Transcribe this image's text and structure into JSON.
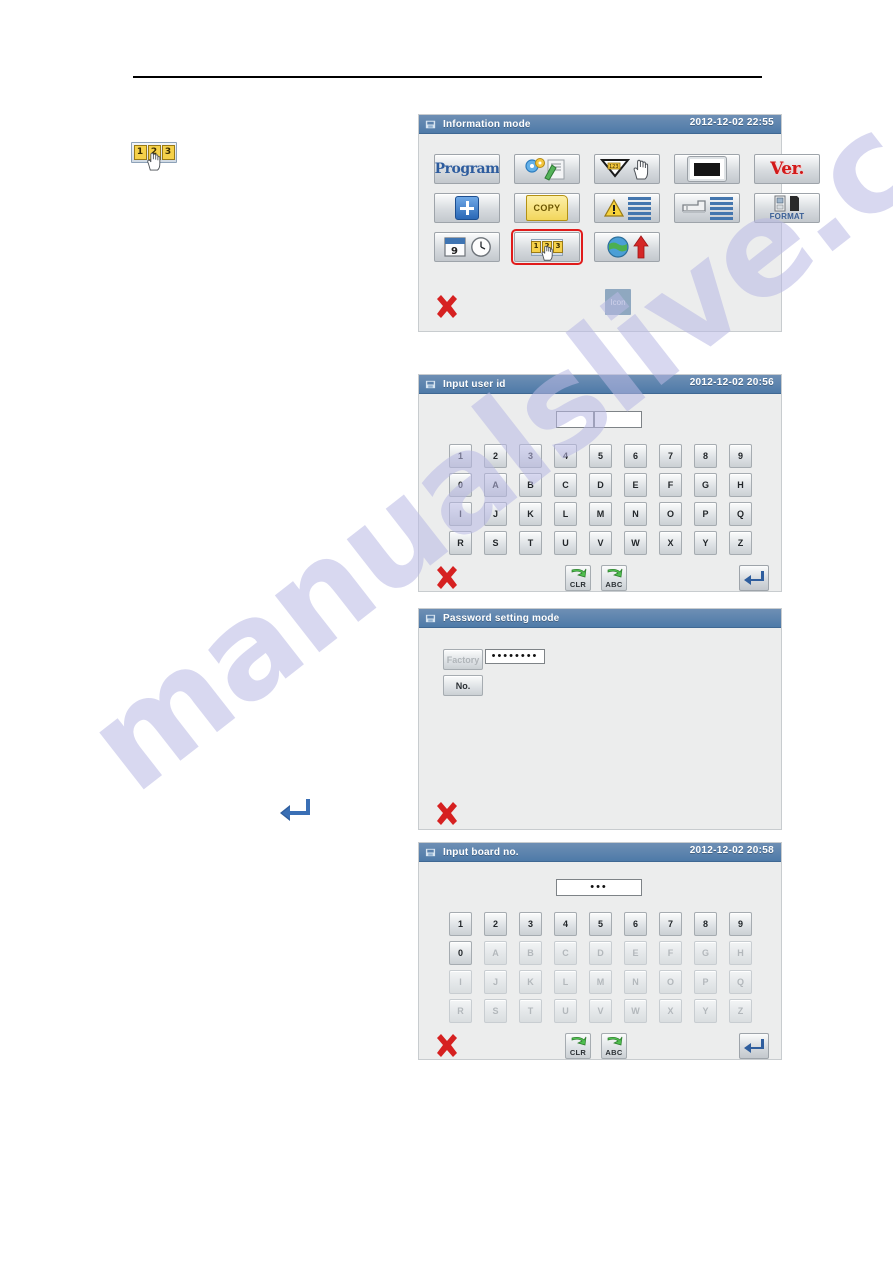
{
  "watermark": {
    "text": "manualslive.com"
  },
  "margin_icon": {
    "name": "123-hand-icon",
    "digits": [
      "1",
      "2",
      "3"
    ]
  },
  "margin_return_icon": {
    "name": "return-arrow-icon"
  },
  "colors": {
    "titlebar_from": "#6e8fb4",
    "titlebar_to": "#4e7aa8",
    "selection_red": "#e01b1b",
    "program_blue": "#2d5c9e",
    "ver_red": "#d21919",
    "screen_bg": "#eceded"
  },
  "panels": [
    {
      "id": "information-mode",
      "title": "Information mode",
      "clock": "2012-12-02  22:55",
      "tiles": [
        {
          "name": "program-button",
          "label": "Program",
          "kind": "text-program",
          "selected": false
        },
        {
          "name": "sewing-settings-button",
          "label": "",
          "kind": "gear-paper",
          "selected": false
        },
        {
          "name": "needle-thread-tension-button",
          "label": "",
          "kind": "funnel-hand",
          "selected": false
        },
        {
          "name": "display-brightness-button",
          "label": "",
          "kind": "screen",
          "selected": false
        },
        {
          "name": "version-button",
          "label": "Ver.",
          "kind": "text-ver",
          "selected": false
        },
        {
          "name": "add-button",
          "label": "",
          "kind": "plus",
          "selected": false
        },
        {
          "name": "copy-button",
          "label": "COPY",
          "kind": "copy-folder",
          "selected": false
        },
        {
          "name": "error-log-button",
          "label": "",
          "kind": "warn-list",
          "selected": false
        },
        {
          "name": "machine-log-button",
          "label": "",
          "kind": "machine-list",
          "selected": false
        },
        {
          "name": "format-button",
          "label": "FORMAT",
          "kind": "format",
          "selected": false
        },
        {
          "name": "date-time-button",
          "label": "",
          "kind": "calendar-clock",
          "selected": false
        },
        {
          "name": "password-button",
          "label": "",
          "kind": "icon-123",
          "selected": true
        },
        {
          "name": "communication-upload-button",
          "label": "",
          "kind": "globe-arrow",
          "selected": false
        }
      ],
      "close_button": {
        "name": "close-button",
        "label": ""
      },
      "icon_button": {
        "name": "icon-button",
        "label": "Icon"
      }
    },
    {
      "id": "input-user-id",
      "title": "Input user id",
      "clock": "2012-12-02  20:56",
      "field_value": "",
      "keys": [
        [
          "1",
          "2",
          "3",
          "4",
          "5",
          "6",
          "7",
          "8",
          "9"
        ],
        [
          "0",
          "A",
          "B",
          "C",
          "D",
          "E",
          "F",
          "G",
          "H"
        ],
        [
          "I",
          "J",
          "K",
          "L",
          "M",
          "N",
          "O",
          "P",
          "Q"
        ],
        [
          "R",
          "S",
          "T",
          "U",
          "V",
          "W",
          "X",
          "Y",
          "Z"
        ]
      ],
      "dim_rows": [],
      "close_button": {
        "name": "close-button",
        "label": ""
      },
      "clr_button": {
        "name": "clear-button",
        "label": "CLR"
      },
      "abc_button": {
        "name": "abc-button",
        "label": "ABC"
      },
      "enter_button": {
        "name": "enter-button",
        "label": ""
      }
    },
    {
      "id": "password-setting-mode",
      "title": "Password setting mode",
      "clock": "",
      "factory_button": {
        "name": "factory-button",
        "label": "Factory",
        "disabled": true
      },
      "no_button": {
        "name": "number-button",
        "label": "No.",
        "disabled": false
      },
      "password_field": {
        "name": "password-field",
        "value": "••••••••"
      },
      "close_button": {
        "name": "close-button",
        "label": ""
      }
    },
    {
      "id": "input-board-no",
      "title": "Input board no.",
      "clock": "2012-12-02  20:58",
      "field_value": "•••",
      "keys": [
        [
          "1",
          "2",
          "3",
          "4",
          "5",
          "6",
          "7",
          "8",
          "9"
        ],
        [
          "0",
          "A",
          "B",
          "C",
          "D",
          "E",
          "F",
          "G",
          "H"
        ],
        [
          "I",
          "J",
          "K",
          "L",
          "M",
          "N",
          "O",
          "P",
          "Q"
        ],
        [
          "R",
          "S",
          "T",
          "U",
          "V",
          "W",
          "X",
          "Y",
          "Z"
        ]
      ],
      "dim_rows": [
        1,
        2,
        3
      ],
      "dim_first_row_exception": 0,
      "close_button": {
        "name": "close-button",
        "label": ""
      },
      "clr_button": {
        "name": "clear-button",
        "label": "CLR"
      },
      "abc_button": {
        "name": "abc-button",
        "label": "ABC"
      },
      "enter_button": {
        "name": "enter-button",
        "label": ""
      }
    }
  ]
}
